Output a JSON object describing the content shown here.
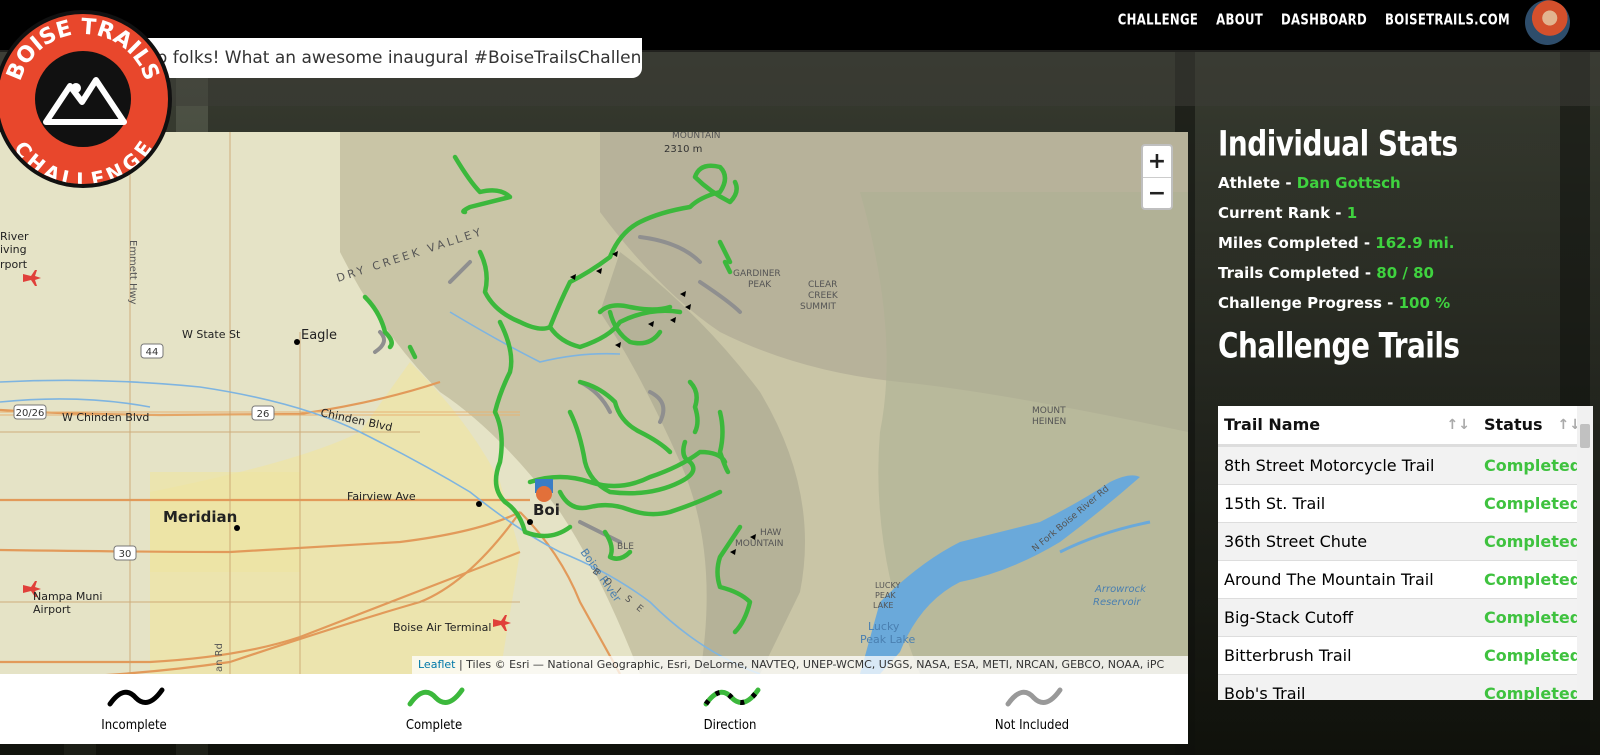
{
  "nav": {
    "links": [
      "CHALLENGE",
      "ABOUT",
      "DASHBOARD",
      "BOISETRAILS.COM"
    ]
  },
  "banner": {
    "tweet_text": "mp folks! What an awesome inaugural #BoiseTrailsChallenge!"
  },
  "logo": {
    "top_text": "BOISE TRAILS",
    "bottom_text": "CHALLENGE"
  },
  "map": {
    "labels": {
      "eagle": "Eagle",
      "meridian": "Meridian",
      "boise": "Boi",
      "nampa_airport_1": "Nampa Muni",
      "nampa_airport_2": "Airport",
      "boise_air": "Boise Air Terminal",
      "state_st": "W State St",
      "chinden": "W Chinden Blvd",
      "chinden2": "Chinden Blvd",
      "fairview": "Fairview Ave",
      "dry_creek": "DRY CREEK VALLEY",
      "gardiner": "GARDINER",
      "gardiner2": "PEAK",
      "clear_creek": "CLEAR",
      "clear_creek2": "CREEK",
      "clear_creek3": "SUMMIT",
      "mount_heinen": "MOUNT",
      "mount_heinen2": "HEINEN",
      "mountain": "MOUNTAIN",
      "elev": "2310 m",
      "lucky_peak": "LUCKY",
      "lucky_peak2": "PEAK",
      "lucky_peak3": "LAKE",
      "lucky_lake": "Lucky",
      "lucky_lake2": "Peak Lake",
      "arrowrock": "Arrowrock",
      "arrowrock2": "Reservoir",
      "boise_river": "Boise River",
      "boise_vert": "B O I S E",
      "emmett": "Emmett Hwy",
      "river_living": "River",
      "living": "iving",
      "airport_left": "rport",
      "shaw": "HAW",
      "shaw2": "MOUNTAIN",
      "table": "BLE",
      "nforkroad": "N Fork Boise River Rd",
      "hwy44": "44",
      "hwy20": "20/26",
      "hwy26": "26",
      "hwy30": "30",
      "road_rd": "an Rd"
    },
    "zoom_in": "+",
    "zoom_out": "−",
    "attribution_link": "Leaflet",
    "attribution_text": " | Tiles © Esri — National Geographic, Esri, DeLorme, NAVTEQ, UNEP-WCMC, USGS, NASA, ESA, METI, NRCAN, GEBCO, NOAA, iPC"
  },
  "legend": {
    "items": [
      {
        "label": "Incomplete",
        "color": "#000000"
      },
      {
        "label": "Complete",
        "color": "#3cb83c"
      },
      {
        "label": "Direction",
        "color": "#3cb83c"
      },
      {
        "label": "Not Included",
        "color": "#999999"
      }
    ]
  },
  "stats": {
    "title": "Individual Stats",
    "rows": [
      {
        "label": "Athlete - ",
        "value": "Dan Gottsch"
      },
      {
        "label": "Current Rank - ",
        "value": "1"
      },
      {
        "label": "Miles Completed - ",
        "value": "162.9 mi."
      },
      {
        "label": "Trails Completed - ",
        "value": "80 / 80"
      },
      {
        "label": "Challenge Progress - ",
        "value": "100 %"
      }
    ]
  },
  "trails": {
    "title": "Challenge Trails",
    "headers": {
      "name": "Trail Name",
      "status": "Status"
    },
    "sort_icon": "↑↓",
    "rows": [
      {
        "name": "8th Street Motorcycle Trail",
        "status": "Completed"
      },
      {
        "name": "15th St. Trail",
        "status": "Completed"
      },
      {
        "name": "36th Street Chute",
        "status": "Completed"
      },
      {
        "name": "Around The Mountain Trail",
        "status": "Completed"
      },
      {
        "name": "Big-Stack Cutoff",
        "status": "Completed"
      },
      {
        "name": "Bitterbrush Trail",
        "status": "Completed"
      },
      {
        "name": "Bob's Trail",
        "status": "Completed"
      }
    ]
  },
  "colors": {
    "accent_green": "#3fd23f",
    "logo_red": "#e8472c",
    "nav_bg": "#000000"
  }
}
